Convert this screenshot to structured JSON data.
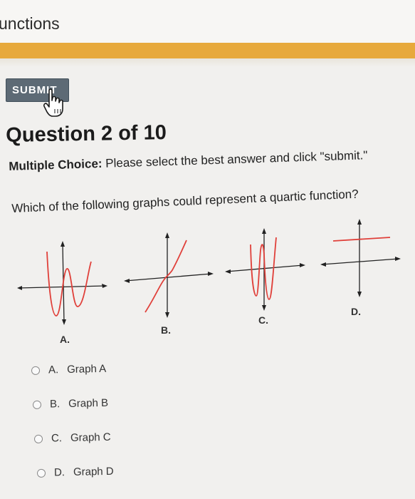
{
  "header": {
    "title": "unctions"
  },
  "colors": {
    "accent": "#e7a93c",
    "submit_bg": "#5d6a75",
    "curve": "#e0403a"
  },
  "submit": {
    "label": "SUBMIT"
  },
  "question": {
    "title": "Question 2 of 10",
    "type_label": "Multiple Choice:",
    "instructions": "Please select the best answer and click \"submit.\"",
    "prompt": "Which of the following graphs could represent a quartic function?"
  },
  "graphs": [
    {
      "label": "A."
    },
    {
      "label": "B."
    },
    {
      "label": "C."
    },
    {
      "label": "D."
    }
  ],
  "options": [
    {
      "letter": "A.",
      "text": "Graph A",
      "selected": false
    },
    {
      "letter": "B.",
      "text": "Graph B",
      "selected": false
    },
    {
      "letter": "C.",
      "text": "Graph C",
      "selected": false
    },
    {
      "letter": "D.",
      "text": "Graph D",
      "selected": false
    }
  ]
}
